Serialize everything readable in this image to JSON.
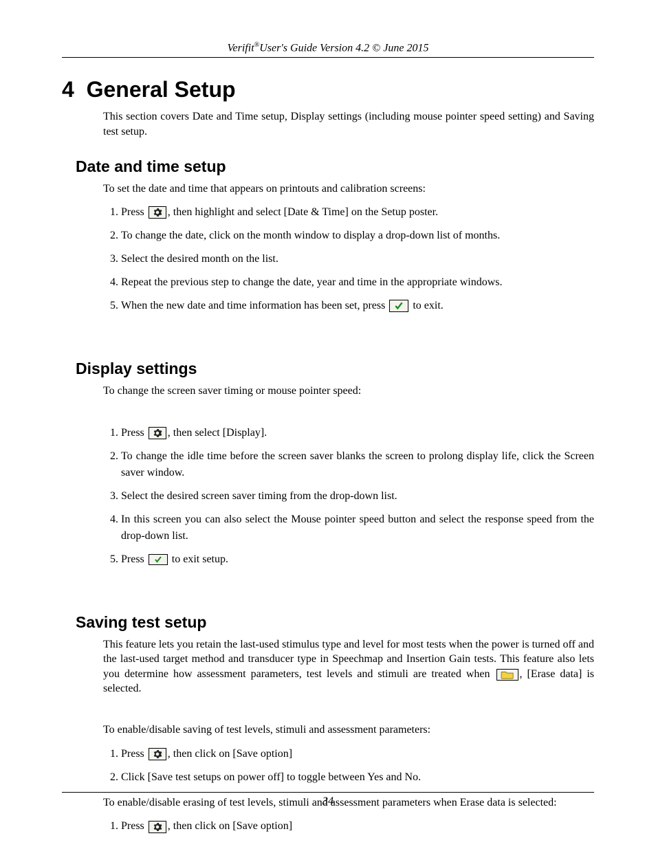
{
  "header": {
    "prefix": "Verifit",
    "sup": "®",
    "suffix": "User's Guide Version 4.2 © June 2015"
  },
  "chapter": {
    "number": "4",
    "title": "General Setup",
    "intro": "This section covers Date and Time setup, Display settings (including mouse pointer speed setting) and Saving test setup."
  },
  "sections": {
    "datetime": {
      "title": "Date and time setup",
      "intro": "To set the date and time that appears on printouts and calibration screens:",
      "steps": {
        "s1a": "Press ",
        "s1b": ", then highlight and select  [Date & Time] on the Setup poster.",
        "s2": "To change the date, click on the month window to display a drop-down list of months.",
        "s3": "Select the desired month on the list.",
        "s4": "Repeat the previous step to change the date, year and time in the appropriate windows.",
        "s5a": "When the new date and time information has been set, press  ",
        "s5b": " to exit."
      }
    },
    "display": {
      "title": "Display settings",
      "intro": "To change the screen saver timing or mouse pointer speed:",
      "steps": {
        "s1a": "Press ",
        "s1b": ", then select [Display].",
        "s2": "To change the idle time before the screen saver blanks the screen to prolong display life, click the Screen saver window.",
        "s3": "Select the desired screen saver timing from the drop-down list.",
        "s4": "In this screen you can also select the Mouse pointer speed button and select the response speed from the drop-down list.",
        "s5a": "Press ",
        "s5b": " to exit setup."
      }
    },
    "saving": {
      "title": "Saving test setup",
      "intro_a": "This feature lets you retain the last-used stimulus type and level for most tests when the power is turned off and the last-used target method and transducer type in Speechmap and Insertion Gain tests.  This feature also lets you determine how assessment parameters, test levels and stimuli are treated when ",
      "intro_b": ", [Erase data] is selected.",
      "para2": "To enable/disable saving of test levels, stimuli and assessment parameters:",
      "steps1": {
        "s1a": "Press ",
        "s1b": ", then click on [Save option]",
        "s2": "Click [Save test setups on power off] to toggle between Yes and No."
      },
      "para3": "To enable/disable erasing of test levels, stimuli and assessment parameters when Erase data is selected:",
      "steps2": {
        "s1a": "Press ",
        "s1b": ", then click on [Save option]"
      }
    }
  },
  "footer": {
    "page": "34"
  }
}
